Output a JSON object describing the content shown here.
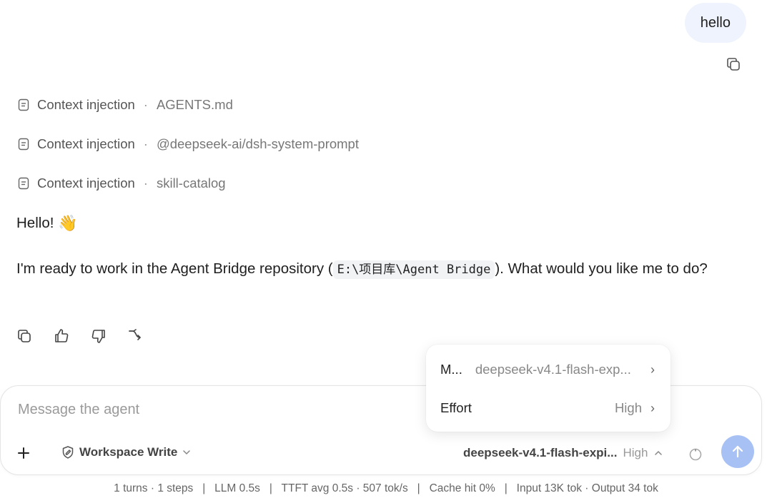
{
  "user_message": {
    "text": "hello"
  },
  "context_injections": [
    {
      "label": "Context injection",
      "source": "AGENTS.md"
    },
    {
      "label": "Context injection",
      "source": "@deepseek-ai/dsh-system-prompt"
    },
    {
      "label": "Context injection",
      "source": "skill-catalog"
    }
  ],
  "assistant": {
    "greeting": "Hello!",
    "greeting_emoji": "👋",
    "message_before": "I'm ready to work in the Agent Bridge repository (",
    "message_code": "E:\\项目库\\Agent Bridge",
    "message_after": "). What would you like me to do?"
  },
  "composer": {
    "placeholder": "Message the agent",
    "mode_label": "Workspace Write",
    "model_label": "deepseek-v4.1-flash-expi...",
    "effort_label": "High"
  },
  "popup_menu": {
    "model_label": "M...",
    "model_value": "deepseek-v4.1-flash-exp...",
    "effort_label": "Effort",
    "effort_value": "High"
  },
  "stats": {
    "turns": "1 turns · 1 steps",
    "llm": "LLM 0.5s",
    "ttft": "TTFT avg 0.5s · 507 tok/s",
    "cache": "Cache hit 0%",
    "tokens": "Input 13K tok · Output 34 tok"
  },
  "colors": {
    "user_bubble_bg": "#eef3fd",
    "send_button_bg": "#a8c1f5",
    "code_bg": "#f2f3f5"
  }
}
